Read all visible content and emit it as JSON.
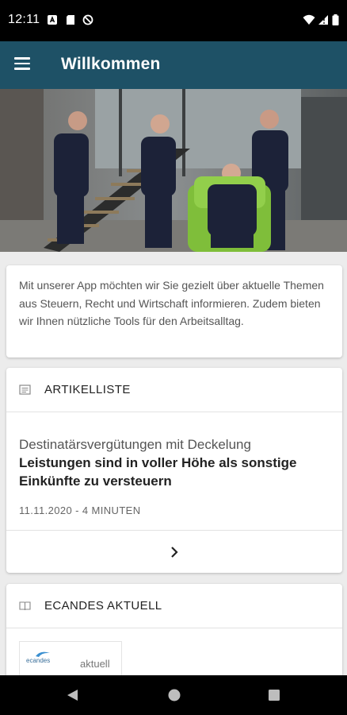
{
  "status_bar": {
    "time": "12:11"
  },
  "app_bar": {
    "title": "Willkommen"
  },
  "intro": {
    "text": "Mit unserer App möchten wir Sie gezielt über aktuelle Themen aus Steuern, Recht und Wirtschaft informieren. Zudem bieten wir Ihnen nützliche Tools für den Arbeitsalltag."
  },
  "article_list": {
    "header": "ARTIKELLISTE",
    "item": {
      "subtitle": "Destinatärsvergütungen mit Deckelung",
      "title": "Leistungen sind in voller Höhe als sonstige Einkünfte zu versteuern",
      "meta": "11.11.2020 - 4 MINUTEN"
    }
  },
  "aktuell": {
    "header": "ECANDES AKTUELL",
    "thumb_logo": "ecandes",
    "thumb_text": "aktuell"
  },
  "colors": {
    "app_bar": "#1e5166",
    "status_bar": "#000000",
    "background": "#ececec"
  }
}
